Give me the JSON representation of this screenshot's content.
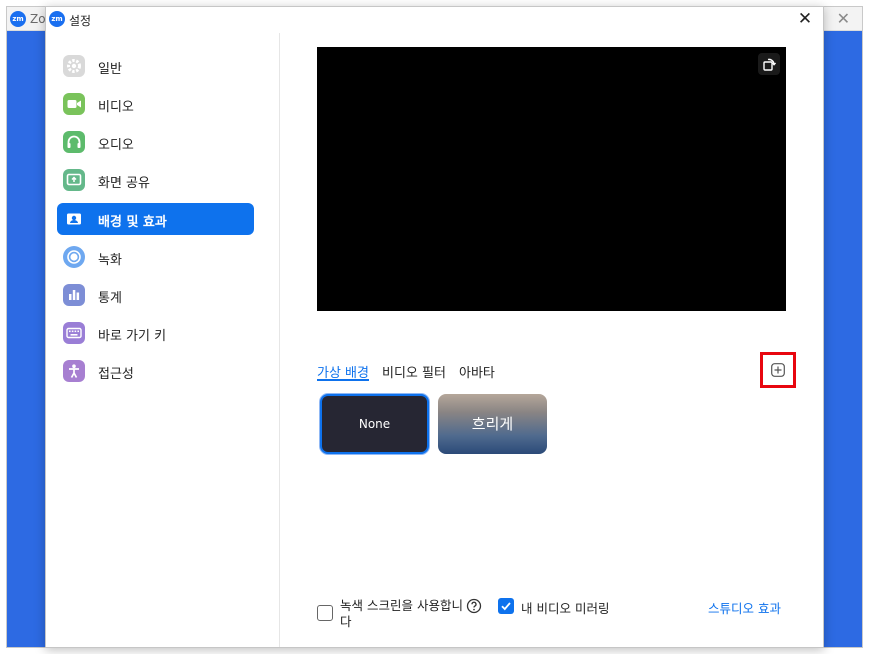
{
  "background_window": {
    "logo": "zm",
    "title": "Zo"
  },
  "dialog": {
    "logo": "zm",
    "title": "설정",
    "close_icon": "close-icon"
  },
  "sidebar": {
    "items": [
      {
        "label": "일반",
        "icon": "gear-icon",
        "color": "#d9d9d9"
      },
      {
        "label": "비디오",
        "icon": "video-camera-icon",
        "color": "#7ac35b"
      },
      {
        "label": "오디오",
        "icon": "headphones-icon",
        "color": "#5dbb6c"
      },
      {
        "label": "화면 공유",
        "icon": "share-screen-icon",
        "color": "#64b88a"
      },
      {
        "label": "배경 및 효과",
        "icon": "portrait-icon",
        "color": "#ffffff",
        "active": true
      },
      {
        "label": "녹화",
        "icon": "record-icon",
        "color": "#6ea8f0"
      },
      {
        "label": "통계",
        "icon": "statistics-icon",
        "color": "#7d8ed6"
      },
      {
        "label": "바로 가기 키",
        "icon": "keyboard-icon",
        "color": "#9a7ed6"
      },
      {
        "label": "접근성",
        "icon": "accessibility-icon",
        "color": "#a77fd1"
      }
    ]
  },
  "tabs": [
    {
      "label": "가상 배경",
      "active": true
    },
    {
      "label": "비디오 필터"
    },
    {
      "label": "아바타"
    }
  ],
  "backgrounds": [
    {
      "label": "None",
      "selected": true
    },
    {
      "label": "흐리게"
    }
  ],
  "options": {
    "green_screen_label": "녹색 스크린을 사용합니다",
    "green_screen_checked": false,
    "mirror_label": "내 비디오 미러링",
    "mirror_checked": true,
    "studio_effects_link": "스튜디오 효과"
  },
  "colors": {
    "accent": "#0e72ed",
    "highlight_border": "#e8060f",
    "preview_bg": "#000000"
  }
}
